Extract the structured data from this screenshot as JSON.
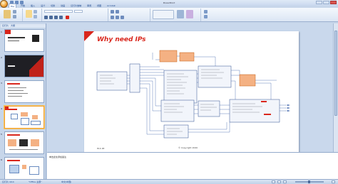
{
  "window": {
    "title": "PowerPoint"
  },
  "ribbon_tabs": [
    {
      "label": "File",
      "active": true
    },
    {
      "label": "开始"
    },
    {
      "label": "插入"
    },
    {
      "label": "设计"
    },
    {
      "label": "切换"
    },
    {
      "label": "动画"
    },
    {
      "label": "幻灯片放映"
    },
    {
      "label": "审阅"
    },
    {
      "label": "视图"
    },
    {
      "label": "Acrobat"
    }
  ],
  "left_panel": {
    "tabs": [
      "幻灯片",
      "大纲"
    ],
    "thumbnails": [
      {
        "number": "1"
      },
      {
        "number": "2"
      },
      {
        "number": "3"
      },
      {
        "number": "4",
        "selected": true
      },
      {
        "number": "5"
      },
      {
        "number": "6"
      }
    ]
  },
  "slide": {
    "title": "Why need IPs",
    "footer_left": "HLS IPI",
    "footer_center": "© Copyright 2020",
    "accent_color": "#d9261c"
  },
  "notes": {
    "placeholder": "单击此处添加备注"
  },
  "status_bar": {
    "slide_info": "幻灯片 4/14",
    "theme": "\"Office 主题\"",
    "language": "中文(中国)"
  }
}
